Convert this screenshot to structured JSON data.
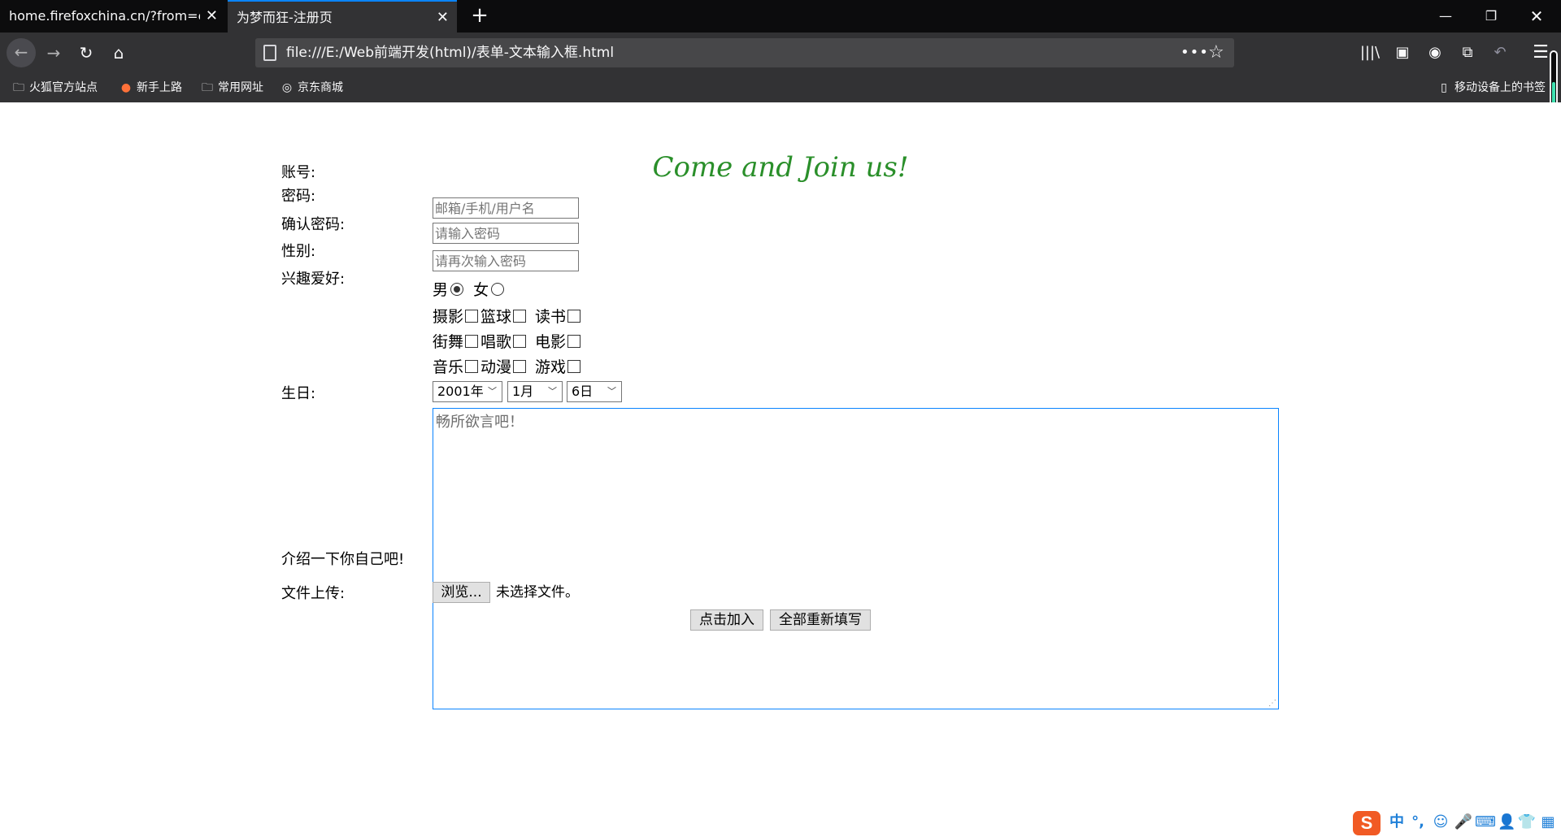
{
  "browser": {
    "tabs": [
      {
        "title": "home.firefoxchina.cn/?from=exte",
        "close": "✕"
      },
      {
        "title": "为梦而狂-注册页",
        "close": "✕"
      }
    ],
    "new_tab": "+",
    "window_controls": {
      "minimize": "—",
      "restore": "❐",
      "close": "✕"
    },
    "url": "file:///E:/Web前端开发(html)/表单-文本输入框.html",
    "page_actions": "•••",
    "bookmarks": [
      {
        "label": "火狐官方站点",
        "icon": "folder-icon"
      },
      {
        "label": "新手上路",
        "icon": "firefox-icon"
      },
      {
        "label": "常用网址",
        "icon": "folder-icon"
      },
      {
        "label": "京东商城",
        "icon": "globe-icon"
      }
    ],
    "mobile_bookmarks": "移动设备上的书签",
    "icons": {
      "back": "←",
      "forward": "→",
      "reload": "↻",
      "home": "⌂",
      "star": "☆",
      "library": "|||\\",
      "sidebar": "▣",
      "account": "◉",
      "screenshot": "⧉",
      "undo": "↶",
      "menu": "☰"
    }
  },
  "form": {
    "title": "Come and Join us!",
    "account_label": "账号:",
    "account_placeholder": "邮箱/手机/用户名",
    "password_label": "密码:",
    "password_placeholder": "请输入密码",
    "confirm_label": "确认密码:",
    "confirm_placeholder": "请再次输入密码",
    "gender_label": "性别:",
    "gender_options": [
      {
        "label": "男",
        "checked": true
      },
      {
        "label": "女",
        "checked": false
      }
    ],
    "hobby_label": "兴趣爱好:",
    "hobbies": [
      [
        "摄影",
        "篮球",
        "读书"
      ],
      [
        "街舞",
        "唱歌",
        "电影"
      ],
      [
        "音乐",
        "动漫",
        "游戏"
      ]
    ],
    "birthday_label": "生日:",
    "birthday": {
      "year": "2001年",
      "month": "1月",
      "day": "6日"
    },
    "intro_label": "介绍一下你自己吧!",
    "intro_placeholder": "畅所欲言吧！",
    "upload_label": "文件上传:",
    "browse_button": "浏览...",
    "file_status": "未选择文件。",
    "submit_button": "点击加入",
    "reset_button": "全部重新填写"
  },
  "ime": {
    "logo": "S",
    "lang": "中",
    "punct": "°,",
    "emoji": "☺",
    "voice": "🎤",
    "keyboard": "⌨",
    "user": "👤",
    "skin": "👕",
    "tools": "▦"
  },
  "colors": {
    "title_green": "#2a8f2a",
    "focus_blue": "#0a84ff",
    "ime_orange": "#f15a24"
  }
}
